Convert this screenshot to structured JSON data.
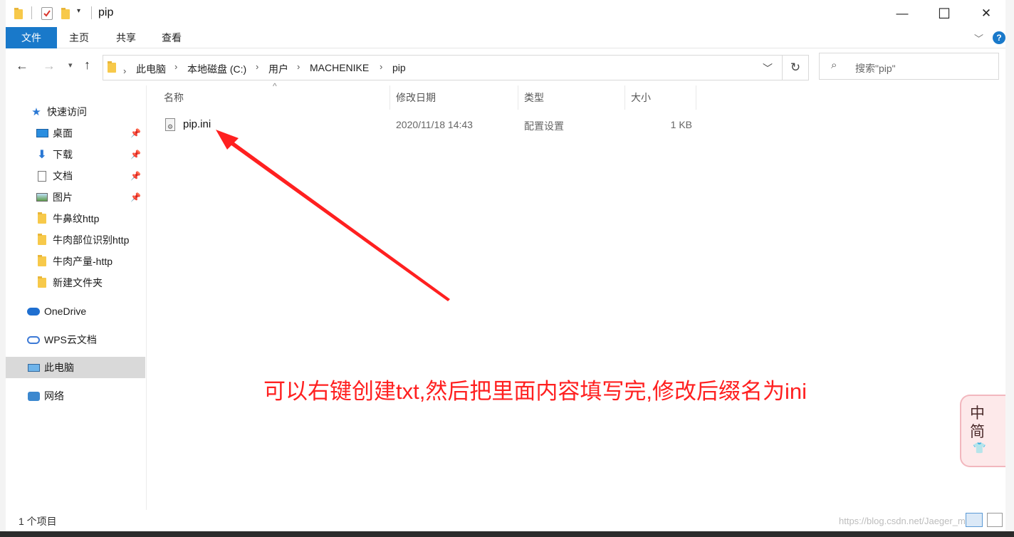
{
  "window": {
    "title": "pip",
    "controls": {
      "minimize": "—",
      "maximize": "☐",
      "close": "✕"
    }
  },
  "ribbon": {
    "tabs": [
      "文件",
      "主页",
      "共享",
      "查看"
    ],
    "help": "?"
  },
  "address": {
    "breadcrumbs": [
      "此电脑",
      "本地磁盘 (C:)",
      "用户",
      "MACHENIKE",
      "pip"
    ],
    "search_placeholder": "搜索\"pip\""
  },
  "nav": {
    "quick_access": "快速访问",
    "pinned": [
      "桌面",
      "下载",
      "文档",
      "图片"
    ],
    "folders": [
      "牛鼻纹http",
      "牛肉部位识别http",
      "牛肉产量-http",
      "新建文件夹"
    ],
    "onedrive": "OneDrive",
    "wps": "WPS云文档",
    "this_pc": "此电脑",
    "network": "网络"
  },
  "columns": {
    "name": "名称",
    "modified": "修改日期",
    "type": "类型",
    "size": "大小"
  },
  "files": [
    {
      "name": "pip.ini",
      "modified": "2020/11/18 14:43",
      "type": "配置设置",
      "size": "1 KB"
    }
  ],
  "annotation": {
    "text": "可以右键创建txt,然后把里面内容填写完,修改后缀名为ini",
    "color": "#ff2020"
  },
  "status": {
    "count": "1 个项目"
  },
  "watermark": "https://blog.csdn.net/Jaeger_m",
  "ime": {
    "line1": "中",
    "line2": "简"
  },
  "accent": "#1979ca"
}
